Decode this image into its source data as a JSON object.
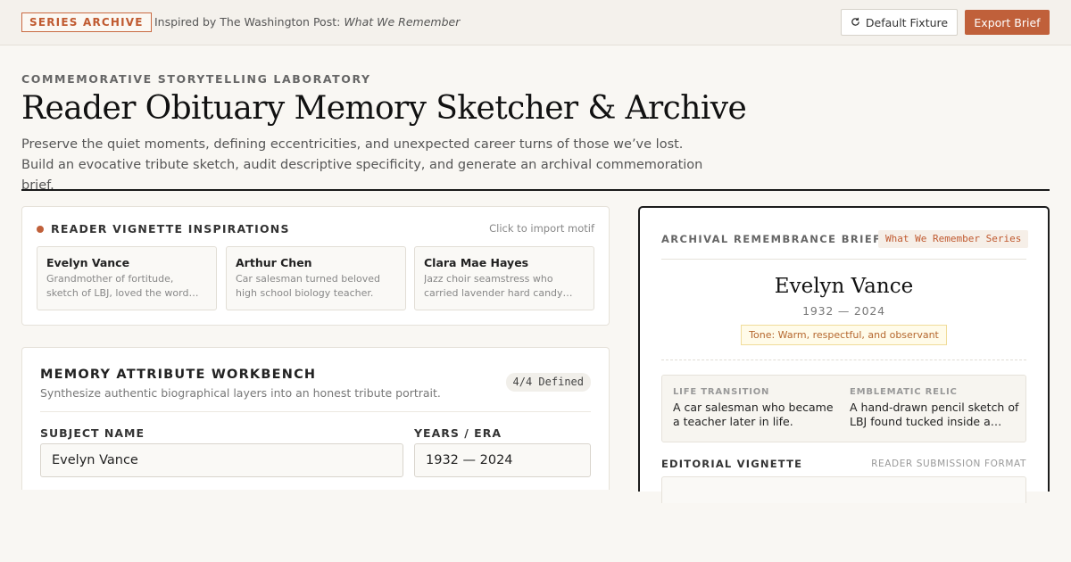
{
  "header": {
    "series_badge": "SERIES ARCHIVE",
    "inspired_prefix": "Inspired by The Washington Post:",
    "inspired_title": "What We Remember",
    "fixture_icon": "refresh-icon",
    "fixture_label": "Default Fixture",
    "export_label": "Export Brief"
  },
  "hero": {
    "eyebrow": "COMMEMORATIVE STORYTELLING LABORATORY",
    "title": "Reader Obituary Memory Sketcher & Archive",
    "description": "Preserve the quiet moments, defining eccentricities, and unexpected career turns of those we’ve lost. Build an evocative tribute sketch, audit descriptive specificity, and generate an archival commemoration brief."
  },
  "inspirations": {
    "title": "READER VIGNETTE INSPIRATIONS",
    "hint": "Click to import motif",
    "items": [
      {
        "name": "Evelyn Vance",
        "desc": "Grandmother of fortitude, sketch of LBJ, loved the word…"
      },
      {
        "name": "Arthur Chen",
        "desc": "Car salesman turned beloved high school biology teacher."
      },
      {
        "name": "Clara Mae Hayes",
        "desc": "Jazz choir seamstress who carried lavender hard candy…"
      }
    ]
  },
  "workbench": {
    "title": "MEMORY ATTRIBUTE WORKBENCH",
    "subtitle": "Synthesize authentic biographical layers into an honest tribute portrait.",
    "badge": "4/4 Defined",
    "name_label": "SUBJECT NAME",
    "name_value": "Evelyn Vance",
    "years_label": "YEARS / ERA",
    "years_value": "1932 — 2024"
  },
  "brief": {
    "label": "ARCHIVAL REMEMBRANCE BRIEF",
    "series": "What We Remember Series",
    "name": "Evelyn Vance",
    "years": "1932 — 2024",
    "tone": "Tone: Warm, respectful, and observant",
    "life_transition_label": "LIFE TRANSITION",
    "life_transition_value": "A car salesman who became a teacher later in life.",
    "relic_label": "EMBLEMATIC RELIC",
    "relic_value": "A hand-drawn pencil sketch of LBJ found tucked inside a we…",
    "editorial_label": "EDITORIAL VIGNETTE",
    "editorial_format": "READER SUBMISSION FORMAT"
  },
  "colors": {
    "accent": "#c0603a",
    "background": "#f9f7f3",
    "ink": "#111111"
  }
}
